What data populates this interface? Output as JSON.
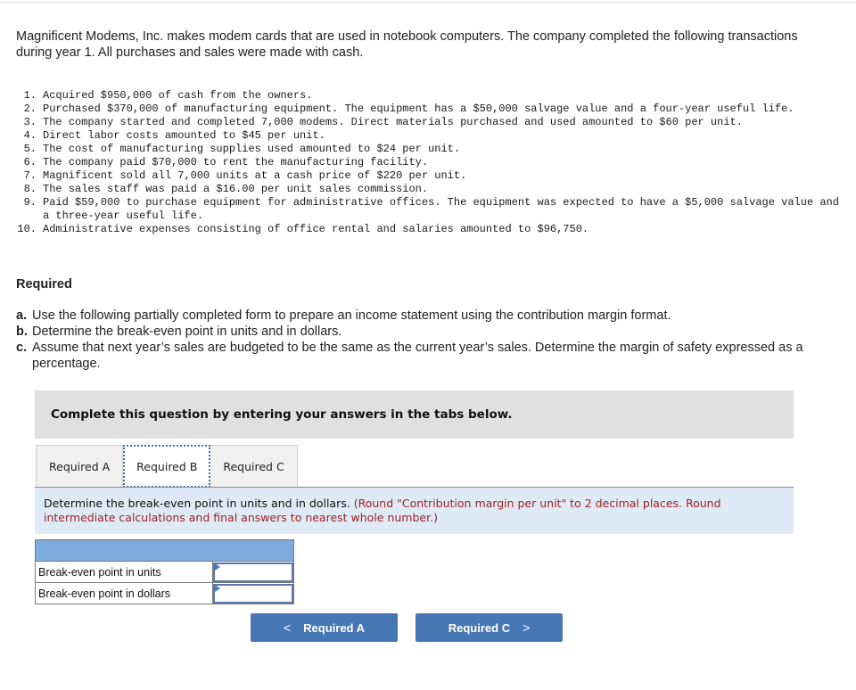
{
  "problem": {
    "intro": "Magnificent Modems, Inc. makes modem cards that are used in notebook computers. The company completed the following transactions during year 1. All purchases and sales were made with cash.",
    "transactions": [
      {
        "num": "1.",
        "text": "Acquired $950,000 of cash from the owners."
      },
      {
        "num": "2.",
        "text": "Purchased $370,000 of manufacturing equipment. The equipment has a $50,000 salvage value and a four-year useful life."
      },
      {
        "num": "3.",
        "text": "The company started and completed 7,000 modems. Direct materials purchased and used amounted to $60 per unit."
      },
      {
        "num": "4.",
        "text": "Direct labor costs amounted to $45 per unit."
      },
      {
        "num": "5.",
        "text": "The cost of manufacturing supplies used amounted to $24 per unit."
      },
      {
        "num": "6.",
        "text": "The company paid $70,000 to rent the manufacturing facility."
      },
      {
        "num": "7.",
        "text": "Magnificent sold all 7,000 units at a cash price of $220 per unit."
      },
      {
        "num": "8.",
        "text": "The sales staff was paid a $16.00 per unit sales commission."
      },
      {
        "num": "9.",
        "text": "Paid $59,000 to purchase equipment for administrative offices. The equipment was expected to have a $5,000 salvage value and a three-year useful life."
      },
      {
        "num": "10.",
        "text": "Administrative expenses consisting of office rental and salaries amounted to $96,750."
      }
    ],
    "required_heading": "Required",
    "requirements": [
      {
        "letter": "a.",
        "text": "Use the following partially completed form to prepare an income statement using the contribution margin format."
      },
      {
        "letter": "b.",
        "text": "Determine the break-even point in units and in dollars."
      },
      {
        "letter": "c.",
        "text": "Assume that next year’s sales are budgeted to be the same as the current year’s sales. Determine the margin of safety expressed as a percentage."
      }
    ]
  },
  "banner": {
    "text": "Complete this question by entering your answers in the tabs below."
  },
  "tabs": [
    {
      "label": "Required A",
      "active": false
    },
    {
      "label": "Required B",
      "active": true
    },
    {
      "label": "Required C",
      "active": false
    }
  ],
  "instruction": {
    "text": "Determine the break-even point in units and in dollars. ",
    "note": "(Round \"Contribution margin per unit\" to 2 decimal places. Round intermediate calculations and final answers to nearest whole number.)"
  },
  "answer_table": {
    "rows": [
      {
        "label": "Break-even point in units",
        "value": ""
      },
      {
        "label": "Break-even point in dollars",
        "value": ""
      }
    ]
  },
  "navigation": {
    "prev_label": "Required A",
    "next_label": "Required C",
    "prev_icon": "<",
    "next_icon": ">"
  }
}
